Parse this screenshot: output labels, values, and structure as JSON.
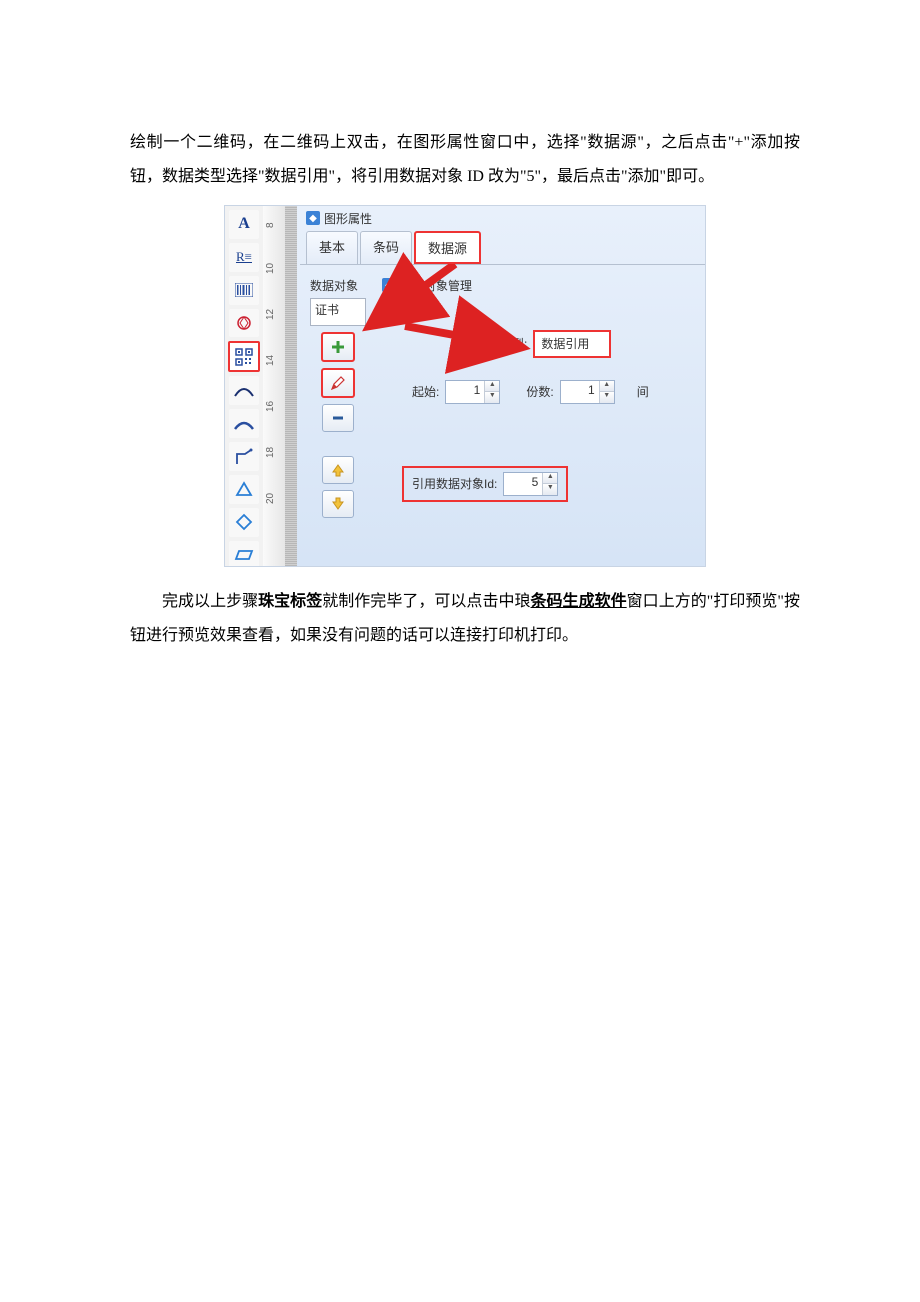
{
  "text": {
    "para1": "绘制一个二维码，在二维码上双击，在图形属性窗口中，选择\"数据源\"，之后点击\"+\"添加按钮，数据类型选择\"数据引用\"，将引用数据对象 ID 改为\"5\"，最后点击\"添加\"即可。",
    "para2_prefix": "完成以上步骤",
    "para2_bold1": "珠宝标签",
    "para2_mid1": "就制作完毕了，可以点击中琅",
    "para2_underline": "条码生成软件",
    "para2_suffix": "窗口上方的\"打印预览\"按钮进行预览效果查看，如果没有问题的话可以连接打印机打印。"
  },
  "ui": {
    "window_title": "图形属性",
    "tabs": {
      "basic": "基本",
      "barcode": "条码",
      "datasrc": "数据源"
    },
    "data_object_label": "数据对象",
    "cert_value": "证书",
    "mgmt_title": "数据对象管理",
    "type_label": "数据对象类型:",
    "type_value": "数据引用",
    "start_label": "起始:",
    "start_value": "1",
    "copies_label": "份数:",
    "copies_value": "1",
    "ref_id_label": "引用数据对象Id:",
    "ref_id_value": "5",
    "ruler": {
      "t8": "8",
      "t10": "10",
      "t12": "12",
      "t14": "14",
      "t16": "16",
      "t18": "18",
      "t20": "20"
    },
    "trailing": "间"
  }
}
